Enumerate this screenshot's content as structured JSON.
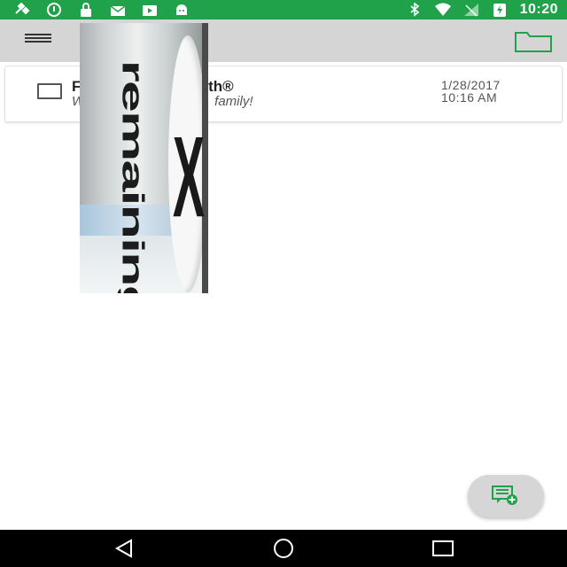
{
  "status_bar": {
    "time": "10:20",
    "left_icons": [
      "satellite-icon",
      "alert-icon",
      "lock-icon",
      "mail-icon",
      "play-store-icon",
      "android-icon"
    ],
    "right_icons": [
      "bluetooth-icon",
      "wifi-icon",
      "signal-icon",
      "battery-charging-icon"
    ]
  },
  "toolbar": {
    "menu_icon": "hamburger-menu-icon",
    "folder_icon": "folder-icon",
    "accent_color": "#1fa24a"
  },
  "message": {
    "title_start": "F",
    "title_end": "lth®",
    "preview_start": "W",
    "preview_end": "family!",
    "date": "1/28/2017",
    "time": "10:16 AM"
  },
  "overlay_ad": {
    "text": "remaining",
    "close_label": "X"
  },
  "fab": {
    "icon": "new-message-icon",
    "accent_color": "#1fa24a"
  },
  "nav_bar": {
    "buttons": [
      "back-icon",
      "home-icon",
      "recents-icon"
    ]
  }
}
